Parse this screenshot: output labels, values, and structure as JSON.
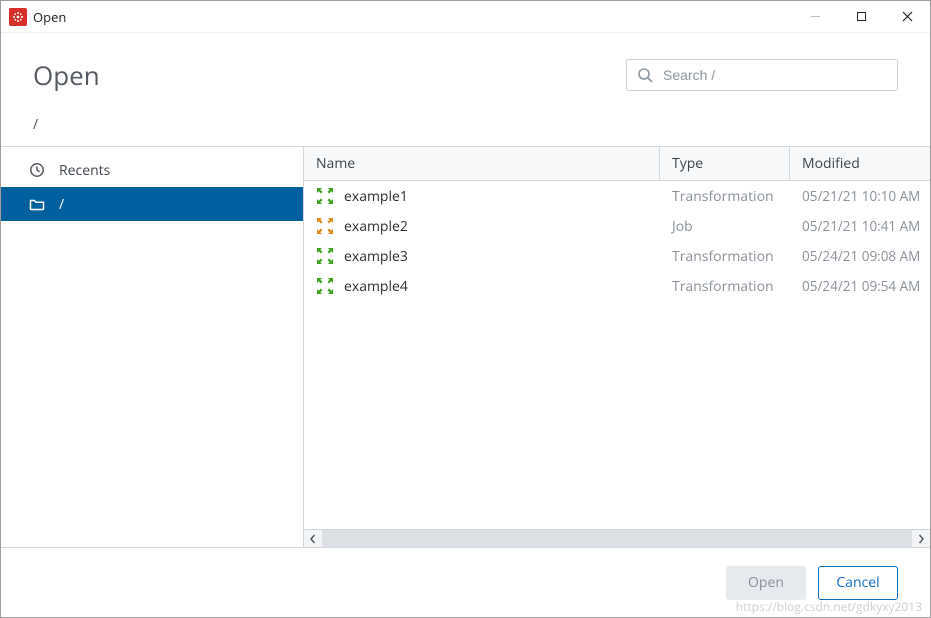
{
  "window": {
    "title": "Open"
  },
  "header": {
    "title": "Open",
    "breadcrumb": "/"
  },
  "search": {
    "placeholder": "Search /"
  },
  "sidebar": {
    "items": [
      {
        "label": "Recents",
        "icon": "clock",
        "selected": false
      },
      {
        "label": "/",
        "icon": "folder",
        "selected": true
      }
    ]
  },
  "columns": {
    "name": "Name",
    "type": "Type",
    "modified": "Modified"
  },
  "files": [
    {
      "name": "example1",
      "type": "Transformation",
      "modified": "05/21/21 10:10 AM",
      "icon": "ktr"
    },
    {
      "name": "example2",
      "type": "Job",
      "modified": "05/21/21 10:41 AM",
      "icon": "kjb"
    },
    {
      "name": "example3",
      "type": "Transformation",
      "modified": "05/24/21 09:08 AM",
      "icon": "ktr"
    },
    {
      "name": "example4",
      "type": "Transformation",
      "modified": "05/24/21 09:54 AM",
      "icon": "ktr"
    }
  ],
  "footer": {
    "open": "Open",
    "cancel": "Cancel"
  },
  "watermark": "https://blog.csdn.net/gdkyxy2013"
}
